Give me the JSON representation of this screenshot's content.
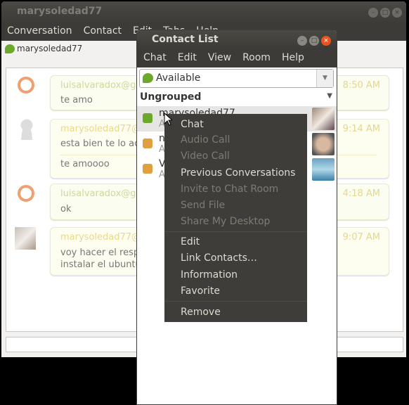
{
  "main_window": {
    "title": "marysoledad77",
    "menu": [
      "Conversation",
      "Contact",
      "Edit",
      "Tabs",
      "Help"
    ],
    "tab_contact": "marysoledad77",
    "messages": [
      {
        "sender": "luisalvaradox@g",
        "time": "8:50 AM",
        "lines": [
          "te amo"
        ],
        "avatar": "ubuntu-logo-icon"
      },
      {
        "sender": "marysoledad77@",
        "time": "9:14 AM",
        "lines": [
          "esta bien te lo ac",
          "te amoooo"
        ],
        "avatar": "default-user-icon"
      },
      {
        "sender": "luisalvaradox@g",
        "time": "4:18 AM",
        "lines": [
          "ok"
        ],
        "avatar": "ubuntu-logo-icon"
      },
      {
        "sender": "marysoledad77@",
        "time": "9:07 AM",
        "lines": [
          "voy hacer el resp",
          "instalar el ubuntu"
        ],
        "avatar": "user-photo"
      }
    ]
  },
  "contact_list": {
    "title": "Contact List",
    "menu": [
      "Chat",
      "Edit",
      "View",
      "Room",
      "Help"
    ],
    "status": "Available",
    "group": "Ungrouped",
    "contacts": [
      {
        "name": "marysoledad77",
        "status": "A"
      },
      {
        "name": "n",
        "status": "A"
      },
      {
        "name": "V",
        "status": "A"
      }
    ]
  },
  "context_menu": {
    "items": [
      {
        "label": "Chat",
        "enabled": true
      },
      {
        "label": "Audio Call",
        "enabled": false
      },
      {
        "label": "Video Call",
        "enabled": false
      },
      {
        "label": "Previous Conversations",
        "enabled": true
      },
      {
        "label": "Invite to Chat Room",
        "enabled": false
      },
      {
        "label": "Send File",
        "enabled": false
      },
      {
        "label": "Share My Desktop",
        "enabled": false
      },
      {
        "label": "Edit",
        "enabled": true
      },
      {
        "label": "Link Contacts…",
        "enabled": true
      },
      {
        "label": "Information",
        "enabled": true
      },
      {
        "label": "Favorite",
        "enabled": true
      },
      {
        "label": "Remove",
        "enabled": true
      }
    ]
  },
  "colors": {
    "titlebar": "#3c3b37",
    "close": "#e95420",
    "available": "#6ca82a"
  }
}
